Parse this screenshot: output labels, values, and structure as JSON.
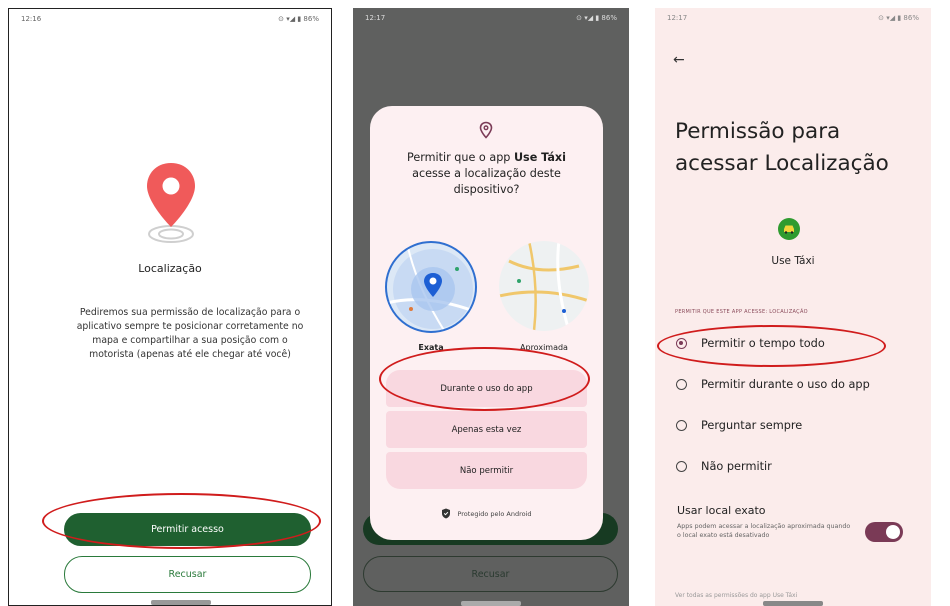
{
  "screen1": {
    "time": "12:16",
    "status_icons": "⊙ ▾◢ ▮ 86%",
    "title": "Localização",
    "description": "Pediremos sua permissão de localização para o aplicativo sempre te posicionar corretamente no mapa e compartilhar a sua posição com o motorista (apenas até ele chegar até você)",
    "allow_button": "Permitir acesso",
    "decline_button": "Recusar"
  },
  "screen2": {
    "time": "12:17",
    "status_icons": "⊙ ▾◢ ▮ 86%",
    "question_pre": "Permitir que o app ",
    "question_app": "Use Táxi",
    "question_post": " acesse a localização deste dispositivo?",
    "exact_label": "Exata",
    "approx_label": "Aproximada",
    "option_while_using": "Durante o uso do app",
    "option_only_once": "Apenas esta vez",
    "option_deny": "Não permitir",
    "protected": "Protegido pelo Android",
    "decline_button": "Recusar"
  },
  "screen3": {
    "time": "12:17",
    "status_icons": "⊙ ▾◢ ▮ 86%",
    "title_line1": "Permissão para",
    "title_line2": "acessar Localização",
    "app_name": "Use Táxi",
    "section_label": "PERMITIR QUE ESTE APP ACESSE: LOCALIZAÇÃO",
    "options": [
      {
        "label": "Permitir o tempo todo",
        "selected": true
      },
      {
        "label": "Permitir durante o uso do app",
        "selected": false
      },
      {
        "label": "Perguntar sempre",
        "selected": false
      },
      {
        "label": "Não permitir",
        "selected": false
      }
    ],
    "exact_title": "Usar local exato",
    "exact_desc": "Apps podem acessar a localização aproximada quando o local exato está desativado",
    "exact_enabled": true,
    "cut_text": "Ver todas as permissões do app Use Táxi"
  },
  "colors": {
    "green_button": "#1f6030",
    "accent_purple": "#7b3b57",
    "highlight_red": "#d01c1c",
    "pin_red": "#f05a5a"
  }
}
